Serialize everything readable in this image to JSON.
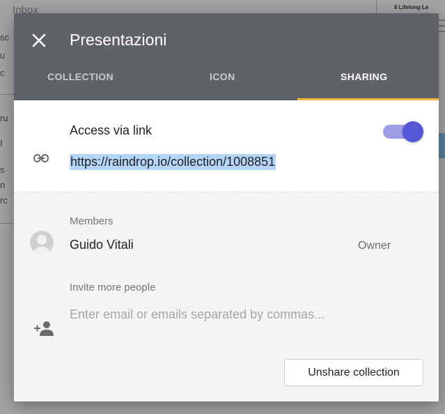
{
  "background": {
    "inbox_label": "Inbox",
    "right_fragment": "Il Lifelong Le",
    "left_fragments": [
      "sc",
      "u",
      "c",
      "",
      "ru",
      "I",
      "s",
      "n",
      "rc"
    ]
  },
  "dialog": {
    "title": "Presentazioni",
    "close_icon": "close-icon",
    "tabs": [
      {
        "label": "COLLECTION",
        "active": false
      },
      {
        "label": "ICON",
        "active": false
      },
      {
        "label": "SHARING",
        "active": true
      }
    ],
    "accent_color": "#f6b73c",
    "link": {
      "label": "Access via link",
      "url": "https://raindrop.io/collection/1008851",
      "enabled": true,
      "icon": "link-icon",
      "toggle_color": "#5558d6"
    },
    "members": {
      "label": "Members",
      "list": [
        {
          "name": "Guido Vitali",
          "role": "Owner",
          "avatar_icon": "avatar-icon"
        }
      ]
    },
    "invite": {
      "label": "Invite more people",
      "placeholder": "Enter email or emails separated by commas...",
      "value": "",
      "icon": "add-person-icon"
    },
    "unshare_label": "Unshare collection"
  }
}
